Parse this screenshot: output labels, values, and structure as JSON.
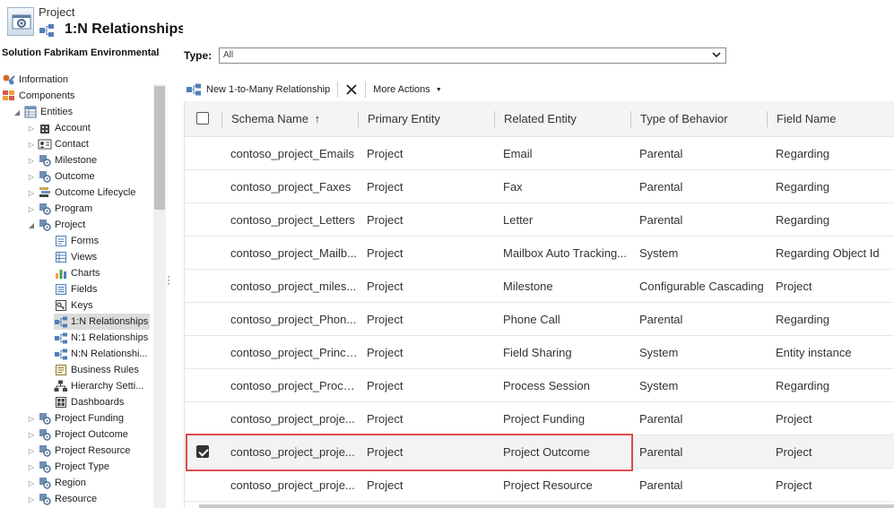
{
  "header": {
    "entity_name": "Project",
    "page_title": "1:N Relationships"
  },
  "sidebar": {
    "solution_title": "Solution Fabrikam Environmental",
    "items": [
      {
        "label": "Information",
        "icon": "information-icon",
        "indent": 0,
        "arrow": ""
      },
      {
        "label": "Components",
        "icon": "components-icon",
        "indent": 0,
        "arrow": ""
      },
      {
        "label": "Entities",
        "icon": "entities-icon",
        "indent": 1,
        "arrow": "◢"
      },
      {
        "label": "Account",
        "icon": "account-entity-icon",
        "indent": 2,
        "arrow": "▷"
      },
      {
        "label": "Contact",
        "icon": "contact-entity-icon",
        "indent": 2,
        "arrow": "▷"
      },
      {
        "label": "Milestone",
        "icon": "milestone-entity-icon",
        "indent": 2,
        "arrow": "▷"
      },
      {
        "label": "Outcome",
        "icon": "outcome-entity-icon",
        "indent": 2,
        "arrow": "▷"
      },
      {
        "label": "Outcome Lifecycle",
        "icon": "outcome-lifecycle-entity-icon",
        "indent": 2,
        "arrow": "▷"
      },
      {
        "label": "Program",
        "icon": "program-entity-icon",
        "indent": 2,
        "arrow": "▷"
      },
      {
        "label": "Project",
        "icon": "project-entity-icon",
        "indent": 2,
        "arrow": "◢"
      },
      {
        "label": "Forms",
        "icon": "forms-icon",
        "indent": 3,
        "arrow": ""
      },
      {
        "label": "Views",
        "icon": "views-icon",
        "indent": 3,
        "arrow": ""
      },
      {
        "label": "Charts",
        "icon": "charts-icon",
        "indent": 3,
        "arrow": ""
      },
      {
        "label": "Fields",
        "icon": "fields-icon",
        "indent": 3,
        "arrow": ""
      },
      {
        "label": "Keys",
        "icon": "keys-icon",
        "indent": 3,
        "arrow": ""
      },
      {
        "label": "1:N Relationships",
        "icon": "one-to-many-icon",
        "indent": 3,
        "arrow": "",
        "selected": true
      },
      {
        "label": "N:1 Relationships",
        "icon": "many-to-one-icon",
        "indent": 3,
        "arrow": ""
      },
      {
        "label": "N:N Relationshi...",
        "icon": "many-to-many-icon",
        "indent": 3,
        "arrow": ""
      },
      {
        "label": "Business Rules",
        "icon": "business-rules-icon",
        "indent": 3,
        "arrow": ""
      },
      {
        "label": "Hierarchy Setti...",
        "icon": "hierarchy-settings-icon",
        "indent": 3,
        "arrow": ""
      },
      {
        "label": "Dashboards",
        "icon": "dashboards-icon",
        "indent": 3,
        "arrow": ""
      },
      {
        "label": "Project Funding",
        "icon": "project-funding-entity-icon",
        "indent": 2,
        "arrow": "▷"
      },
      {
        "label": "Project Outcome",
        "icon": "project-outcome-entity-icon",
        "indent": 2,
        "arrow": "▷"
      },
      {
        "label": "Project Resource",
        "icon": "project-resource-entity-icon",
        "indent": 2,
        "arrow": "▷"
      },
      {
        "label": "Project Type",
        "icon": "project-type-entity-icon",
        "indent": 2,
        "arrow": "▷"
      },
      {
        "label": "Region",
        "icon": "region-entity-icon",
        "indent": 2,
        "arrow": "▷"
      },
      {
        "label": "Resource",
        "icon": "resource-entity-icon",
        "indent": 2,
        "arrow": "▷"
      }
    ]
  },
  "filter": {
    "type_label": "Type:",
    "type_value": "All"
  },
  "toolbar": {
    "new_label": "New 1-to-Many Relationship",
    "more_actions_label": "More Actions"
  },
  "grid": {
    "columns": [
      "Schema Name",
      "Primary Entity",
      "Related Entity",
      "Type of Behavior",
      "Field Name"
    ],
    "sort_indicator": "↑",
    "rows": [
      {
        "schema": "contoso_project_Emails",
        "primary": "Project",
        "related": "Email",
        "behavior": "Parental",
        "field": "Regarding",
        "checked": false
      },
      {
        "schema": "contoso_project_Faxes",
        "primary": "Project",
        "related": "Fax",
        "behavior": "Parental",
        "field": "Regarding",
        "checked": false
      },
      {
        "schema": "contoso_project_Letters",
        "primary": "Project",
        "related": "Letter",
        "behavior": "Parental",
        "field": "Regarding",
        "checked": false
      },
      {
        "schema": "contoso_project_Mailb...",
        "primary": "Project",
        "related": "Mailbox Auto Tracking...",
        "behavior": "System",
        "field": "Regarding Object Id",
        "checked": false
      },
      {
        "schema": "contoso_project_miles...",
        "primary": "Project",
        "related": "Milestone",
        "behavior": "Configurable Cascading",
        "field": "Project",
        "checked": false
      },
      {
        "schema": "contoso_project_Phon...",
        "primary": "Project",
        "related": "Phone Call",
        "behavior": "Parental",
        "field": "Regarding",
        "checked": false
      },
      {
        "schema": "contoso_project_Princi...",
        "primary": "Project",
        "related": "Field Sharing",
        "behavior": "System",
        "field": "Entity instance",
        "checked": false
      },
      {
        "schema": "contoso_project_Proce...",
        "primary": "Project",
        "related": "Process Session",
        "behavior": "System",
        "field": "Regarding",
        "checked": false
      },
      {
        "schema": "contoso_project_proje...",
        "primary": "Project",
        "related": "Project Funding",
        "behavior": "Parental",
        "field": "Project",
        "checked": false
      },
      {
        "schema": "contoso_project_proje...",
        "primary": "Project",
        "related": "Project Outcome",
        "behavior": "Parental",
        "field": "Project",
        "checked": true
      },
      {
        "schema": "contoso_project_proje...",
        "primary": "Project",
        "related": "Project Resource",
        "behavior": "Parental",
        "field": "Project",
        "checked": false
      }
    ]
  },
  "colors": {
    "highlight_border": "#e04b4b",
    "selected_sidebar": "#dcdcdc",
    "grid_header_bg": "#f4f4f4"
  }
}
